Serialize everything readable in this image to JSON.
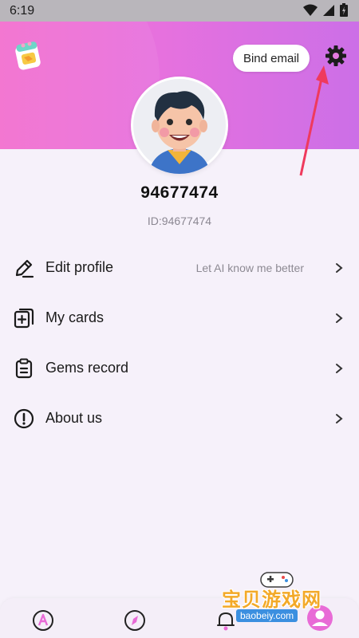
{
  "status_bar": {
    "time": "6:19",
    "icons": [
      "wifi-icon",
      "signal-icon",
      "battery-icon"
    ]
  },
  "header": {
    "bind_email_label": "Bind email",
    "settings_icon": "gear-icon",
    "logo_icon": "app-logo-icon",
    "gradient_colors": [
      "#f36fcf",
      "#cc6fe7"
    ]
  },
  "profile": {
    "username": "94677474",
    "user_id": "ID:94677474"
  },
  "menu": {
    "items": [
      {
        "label": "Edit profile",
        "hint": "Let AI know me better",
        "icon": "pencil-icon"
      },
      {
        "label": "My cards",
        "hint": "",
        "icon": "cards-icon"
      },
      {
        "label": "Gems record",
        "hint": "",
        "icon": "clipboard-icon"
      },
      {
        "label": "About us",
        "hint": "",
        "icon": "info-icon"
      }
    ]
  },
  "bottom_nav": {
    "items": [
      "ai-chat-icon",
      "explore-compass-icon",
      "notifications-bell-icon",
      "profile-icon"
    ],
    "active_color": "#e86bd6"
  },
  "watermark": {
    "text": "宝贝游戏网",
    "domain": "baobeiy.com"
  }
}
